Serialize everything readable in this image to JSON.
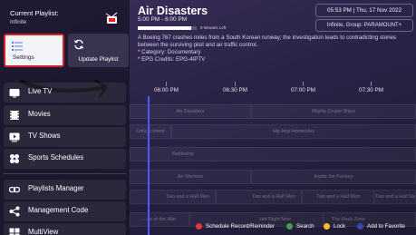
{
  "program": {
    "title": "Air Disasters",
    "time": "5:00 PM - 6:00 PM",
    "progress_fraction": 0.9,
    "time_left": "8 Minutes Left",
    "description": "A Boeing 767 crashes miles from a South Korean runway; the investigation leads to contradicting stories between the surviving pilot and air traffic control.",
    "category": "* Category: Documentary",
    "epg_credits": "* EPG Credits: EPG-4IPTV"
  },
  "header": {
    "datetime": "05:53 PM  |  Thu, 17 Nov 2022",
    "group": "Infinite, Group: PARAMOUNT+"
  },
  "timeline": [
    "06:00 PM",
    "06:30 PM",
    "07:00 PM",
    "07:30 PM"
  ],
  "grid_rows": [
    [
      {
        "title": "Air Disasters"
      },
      {
        "title": "Mighty Cruise Ships"
      }
    ],
    [
      {
        "title": "Critical Intent"
      },
      {
        "title": "Hip Hop Homicides"
      }
    ],
    [
      {
        "title": "Battleship"
      }
    ],
    [
      {
        "title": "Air Warriors"
      },
      {
        "title": "Inside the Factory"
      }
    ],
    [
      {
        "title": "Two and a Half Men"
      },
      {
        "title": "Two and a Half Men"
      },
      {
        "title": "Two and a Half Men"
      },
      {
        "title": "Two and a Half Men"
      }
    ],
    [
      {
        "title": "...ce of the War"
      },
      {
        "title": "Hot Right Now"
      },
      {
        "title": "The Rock Zone"
      }
    ]
  ],
  "legend": [
    {
      "label": "Schedule Record/Reminder",
      "color": "#e53935"
    },
    {
      "label": "Search",
      "color": "#43a047"
    },
    {
      "label": "Lock",
      "color": "#fbc02d"
    },
    {
      "label": "Add to Favorite",
      "color": "#3949ab"
    }
  ],
  "left_panel": {
    "current_playlist_label": "Current Playlist:",
    "current_playlist_value": "Infinite",
    "tiles": {
      "settings": "Settings",
      "update_playlist": "Update Playlist"
    },
    "menu": {
      "live_tv": "Live TV",
      "movies": "Movies",
      "tv_shows": "TV Shows",
      "sports_schedules": "Sports Schedules",
      "playlists_manager": "Playlists Manager",
      "management_code": "Management Code",
      "multiview": "MultiView"
    }
  }
}
